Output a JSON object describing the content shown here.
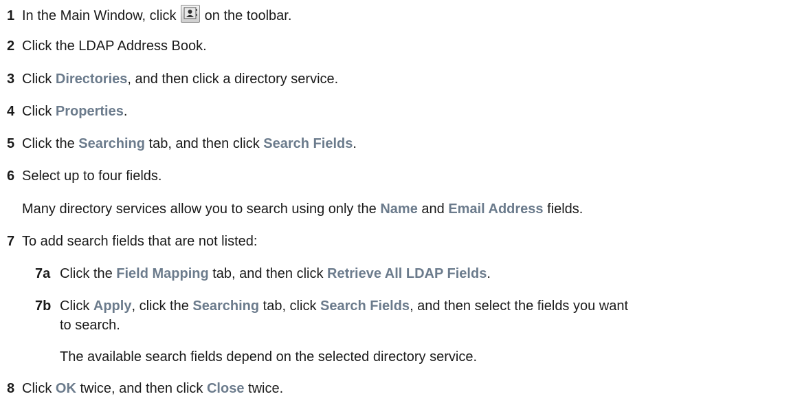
{
  "steps": [
    {
      "num": "1",
      "pre": "In the Main Window, click ",
      "icon": "address-book-icon",
      "post": " on the toolbar."
    },
    {
      "num": "2",
      "text": "Click the LDAP Address Book."
    },
    {
      "num": "3",
      "pre": "Click ",
      "ui1": "Directories",
      "post": ", and then click a directory service."
    },
    {
      "num": "4",
      "pre": "Click ",
      "ui1": "Properties",
      "post": "."
    },
    {
      "num": "5",
      "pre": "Click the ",
      "ui1": "Searching",
      "mid": " tab, and then click ",
      "ui2": "Search Fields",
      "post": "."
    },
    {
      "num": "6",
      "text": "Select up to four fields.",
      "note": {
        "pre": "Many directory services allow you to search using only the ",
        "ui1": "Name",
        "mid": " and ",
        "ui2": "Email Address",
        "post": " fields."
      }
    },
    {
      "num": "7",
      "text": "To add search fields that are not listed:"
    },
    {
      "num": "7a",
      "pre": "Click the ",
      "ui1": "Field Mapping",
      "mid": " tab, and then click ",
      "ui2": "Retrieve All LDAP Fields",
      "post": "."
    },
    {
      "num": "7b",
      "pre": "Click ",
      "ui1": "Apply",
      "mid1": ", click the ",
      "ui2": "Searching",
      "mid2": " tab, click ",
      "ui3": "Search Fields",
      "post": ", and then select the fields you want",
      "cont": "to search.",
      "note": "The available search fields depend on the selected directory service."
    },
    {
      "num": "8",
      "pre": "Click ",
      "ui1": "OK",
      "mid": " twice, and then click ",
      "ui2": "Close",
      "post": " twice."
    }
  ]
}
